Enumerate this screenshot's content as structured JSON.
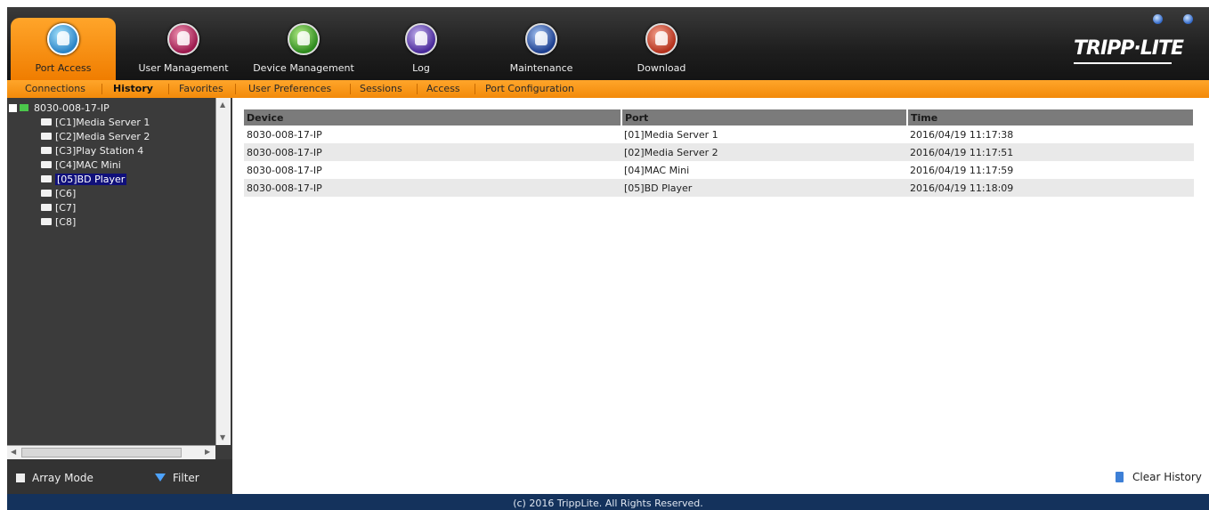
{
  "nav": {
    "tabs": [
      {
        "label": "Port Access",
        "icon": "port-access-icon"
      },
      {
        "label": "User Management",
        "icon": "user-management-icon"
      },
      {
        "label": "Device Management",
        "icon": "device-management-icon"
      },
      {
        "label": "Log",
        "icon": "log-icon"
      },
      {
        "label": "Maintenance",
        "icon": "maintenance-icon"
      },
      {
        "label": "Download",
        "icon": "download-icon"
      }
    ],
    "active_tab": "Port Access",
    "logo_text": "TRIPP·LITE"
  },
  "subnav": {
    "items": [
      "Connections",
      "History",
      "Favorites",
      "User Preferences",
      "Sessions",
      "Access",
      "Port Configuration"
    ],
    "active": "History"
  },
  "tree": {
    "root": "8030-008-17-IP",
    "ports": [
      "[C1]Media Server 1",
      "[C2]Media Server 2",
      "[C3]Play Station 4",
      "[C4]MAC Mini",
      "[05]BD Player",
      "[C6]",
      "[C7]",
      "[C8]"
    ],
    "selected": "[05]BD Player"
  },
  "sidebar_buttons": {
    "array_mode": "Array Mode",
    "filter": "Filter"
  },
  "history": {
    "columns": [
      "Device",
      "Port",
      "Time"
    ],
    "rows": [
      [
        "8030-008-17-IP",
        "[01]Media Server 1",
        "2016/04/19 11:17:38"
      ],
      [
        "8030-008-17-IP",
        "[02]Media Server 2",
        "2016/04/19 11:17:51"
      ],
      [
        "8030-008-17-IP",
        "[04]MAC Mini",
        "2016/04/19 11:17:59"
      ],
      [
        "8030-008-17-IP",
        "[05]BD Player",
        "2016/04/19 11:18:09"
      ]
    ]
  },
  "clear_history": "Clear History",
  "footer": "(c) 2016 TrippLite. All Rights Reserved.",
  "colors": {
    "accent_orange": "#f28a0a",
    "sidebar_bg": "#3b3b3b",
    "footer_bg": "#14325c",
    "selected_bg": "#10107a"
  }
}
